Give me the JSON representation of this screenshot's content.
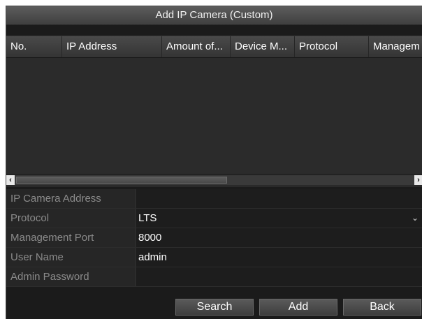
{
  "dialog": {
    "title": "Add IP Camera (Custom)"
  },
  "table": {
    "columns": [
      "No.",
      "IP Address",
      "Amount of...",
      "Device M...",
      "Protocol",
      "Managem"
    ],
    "rows": [],
    "scroll_left_icon": "chevron-left-icon",
    "scroll_right_icon": "chevron-right-icon"
  },
  "form": {
    "ip_camera_address": {
      "label": "IP Camera Address",
      "value": ""
    },
    "protocol": {
      "label": "Protocol",
      "value": "LTS"
    },
    "management_port": {
      "label": "Management Port",
      "value": "8000"
    },
    "user_name": {
      "label": "User Name",
      "value": "admin"
    },
    "admin_password": {
      "label": "Admin Password",
      "value": ""
    }
  },
  "buttons": {
    "search": "Search",
    "add": "Add",
    "back": "Back"
  },
  "colors": {
    "background": "#1b1b1b",
    "header": "#4a4a4a",
    "label_text": "#8a8a8a",
    "value_text": "#ffffff"
  }
}
